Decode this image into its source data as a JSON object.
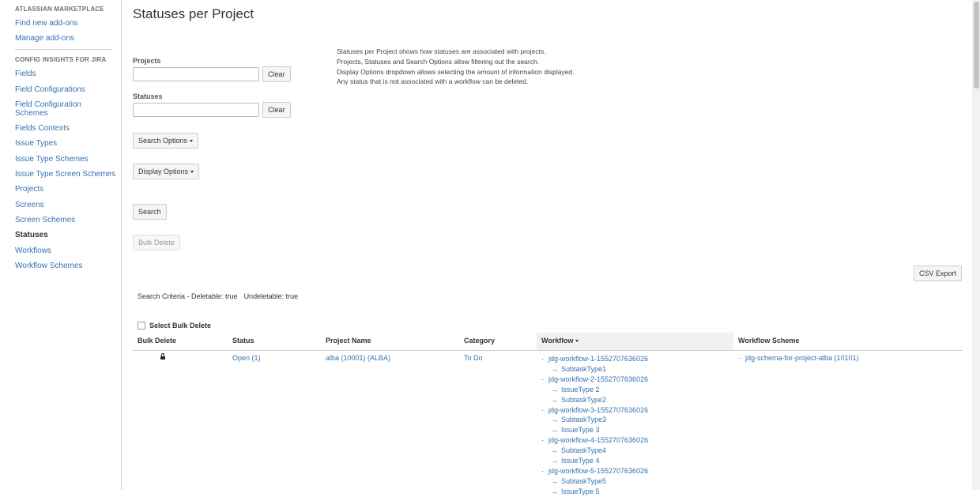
{
  "sidebar": {
    "section1_title": "ATLASSIAN MARKETPLACE",
    "section1_items": [
      "Find new add-ons",
      "Manage add-ons"
    ],
    "section2_title": "CONFIG INSIGHTS FOR JIRA",
    "section2_items": [
      "Fields",
      "Field Configurations",
      "Field Configuration Schemes",
      "Fields Contexts",
      "Issue Types",
      "Issue Type Schemes",
      "Issue Type Screen Schemes",
      "Projects",
      "Screens",
      "Screen Schemes",
      "Statuses",
      "Workflows",
      "Workflow Schemes"
    ],
    "active_item": "Statuses"
  },
  "page": {
    "title": "Statuses per Project",
    "description": [
      "Statuses per Project shows how statuses are associated with projects.",
      "Projects, Statuses and Search Options allow filtering out the search.",
      "Display Options dropdown allows selecting the amount of information displayed.",
      "Any status that is not associated with a workflow can be deleted."
    ]
  },
  "filters": {
    "projects_label": "Projects",
    "projects_value": "",
    "statuses_label": "Statuses",
    "statuses_value": "",
    "clear_label": "Clear",
    "search_options_label": "Search Options",
    "display_options_label": "Display Options",
    "search_label": "Search",
    "bulk_delete_label": "Bulk Delete",
    "csv_export_label": "CSV Export"
  },
  "criteria": {
    "deletable": "Search Criteria - Deletable: true",
    "undeletable": "Undeletable: true"
  },
  "select_bulk_delete": "Select Bulk Delete",
  "table": {
    "headers": [
      "Bulk Delete",
      "Status",
      "Project Name",
      "Category",
      "Workflow",
      "Workflow Scheme"
    ],
    "rows": [
      {
        "locked": true,
        "status": "Open (1)",
        "project": "alba (10001) (ALBA)",
        "category": "To Do",
        "workflows": [
          {
            "name": "jdg-workflow-1-1552707636026",
            "issue_types": [
              "SubtaskType1"
            ]
          },
          {
            "name": "jdg-workflow-2-1552707636026",
            "issue_types": [
              "IssueType 2",
              "SubtaskType2"
            ]
          },
          {
            "name": "jdg-workflow-3-1552707636026",
            "issue_types": [
              "SubtaskType3",
              "IssueType 3"
            ]
          },
          {
            "name": "jdg-workflow-4-1552707636026",
            "issue_types": [
              "SubtaskType4",
              "IssueType 4"
            ]
          },
          {
            "name": "jdg-workflow-5-1552707636026",
            "issue_types": [
              "SubtaskType5",
              "IssueType 5"
            ]
          }
        ],
        "workflow_scheme": "jdg-schema-for-project-alba (10101)"
      }
    ]
  }
}
